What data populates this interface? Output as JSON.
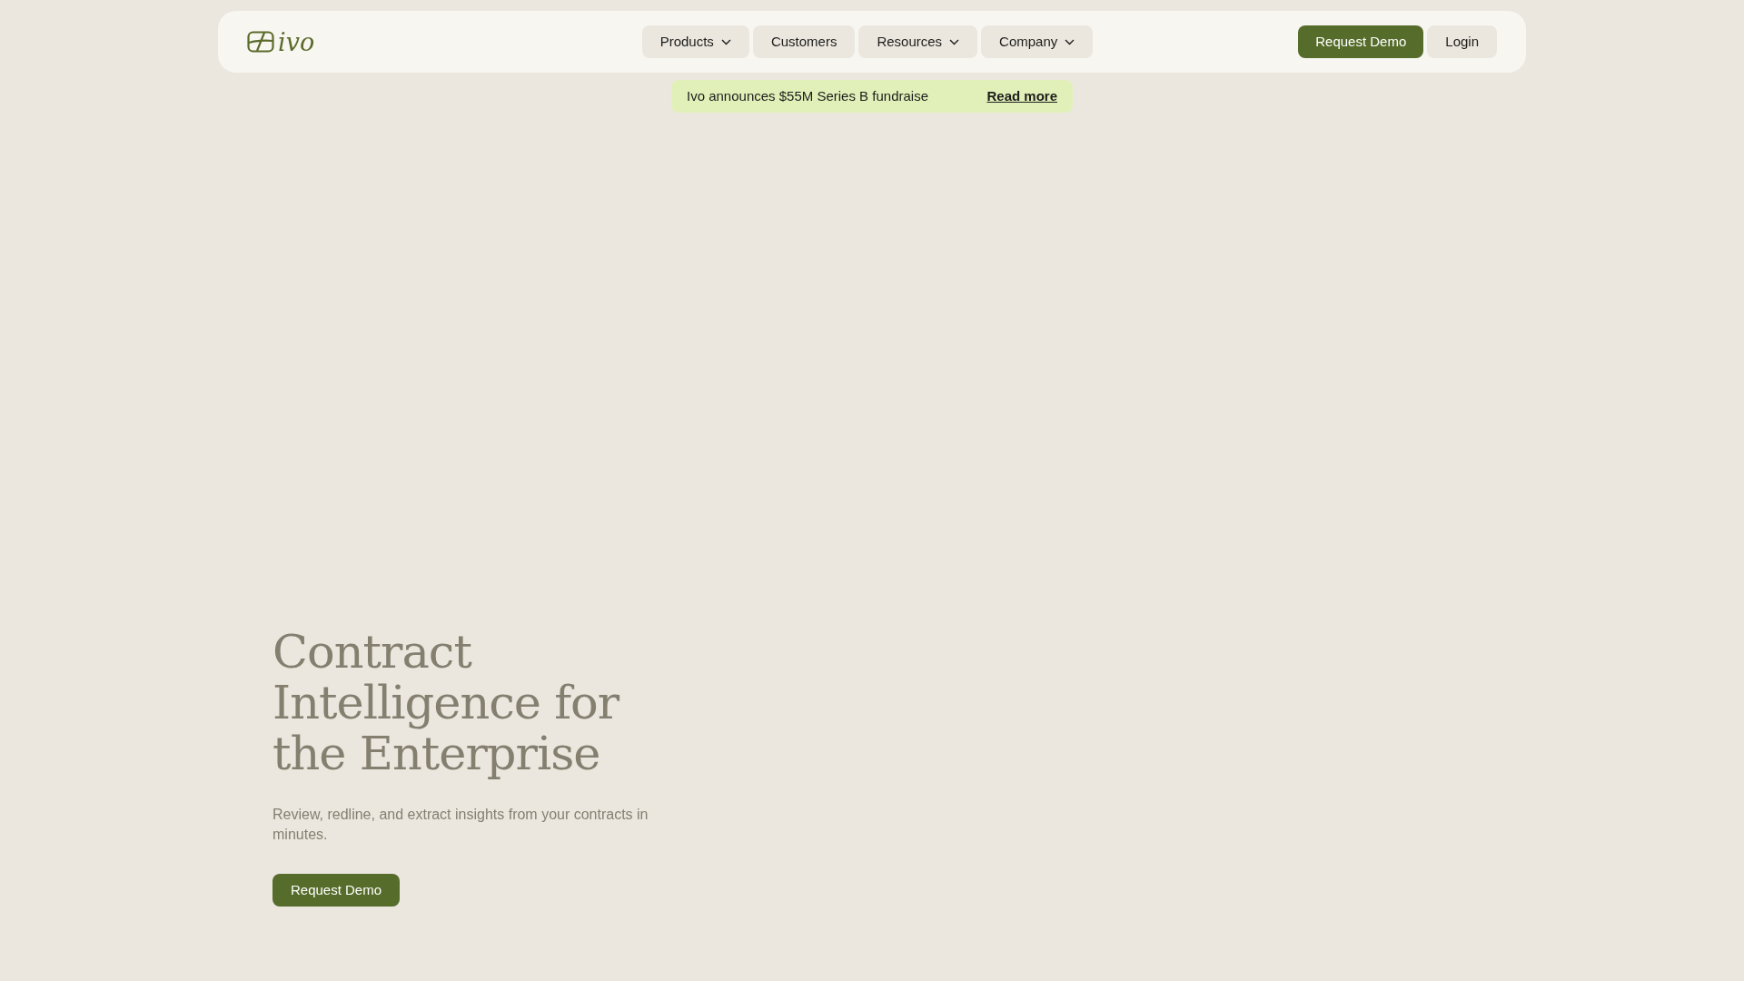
{
  "navbar": {
    "logo": "ivo",
    "menu": [
      {
        "label": "Products",
        "kind": "dropdown"
      },
      {
        "label": "Customers",
        "kind": "link"
      },
      {
        "label": "Resources",
        "kind": "dropdown"
      },
      {
        "label": "Company",
        "kind": "dropdown"
      }
    ],
    "actions": [
      {
        "label": "Request Demo",
        "kind": "primary"
      },
      {
        "label": "Login",
        "kind": "secondary"
      }
    ]
  },
  "announcement": {
    "text": "Ivo announces $55M Series B fundraise",
    "link": "Read more"
  },
  "hero": {
    "title": "Contract Intelligence for the Enterprise",
    "subtitle": "Review, redline, and extract insights from your contracts in minutes.",
    "button": "Request Demo"
  }
}
